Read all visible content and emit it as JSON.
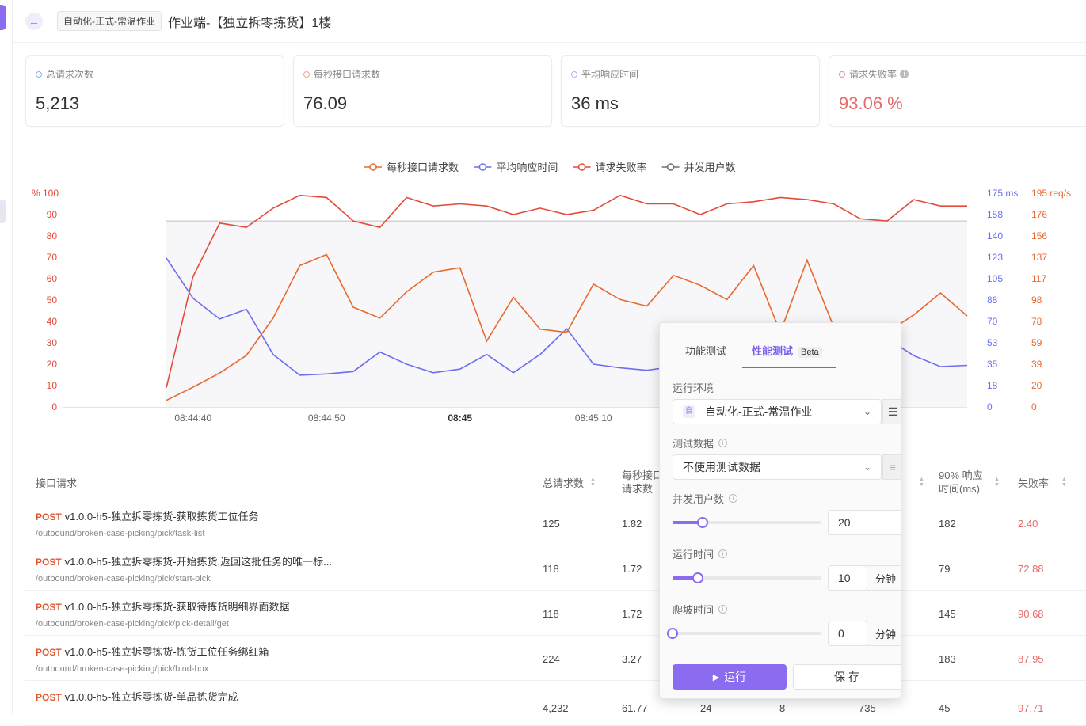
{
  "header": {
    "env_tag": "自动化-正式-常温作业",
    "title": "作业端-【独立拆零拣货】1楼"
  },
  "stats": [
    {
      "label": "总请求次数",
      "value": "5,213",
      "color": "#7fb3f0",
      "value_color": "#333333"
    },
    {
      "label": "每秒接口请求数",
      "value": "76.09",
      "color": "#f0a58a",
      "value_color": "#333333"
    },
    {
      "label": "平均响应时间",
      "value": "36 ms",
      "color": "#b9aef0",
      "value_color": "#333333"
    },
    {
      "label": "请求失败率",
      "value": "93.06 %",
      "color": "#f08a8a",
      "value_color": "#e86a6a"
    }
  ],
  "chart_data": {
    "type": "line",
    "legend": [
      "每秒接口请求数",
      "平均响应时间",
      "请求失败率",
      "并发用户数"
    ],
    "colors": {
      "每秒接口请求数": "#e8692f",
      "平均响应时间": "#6b6ff0",
      "请求失败率": "#e44a3a",
      "并发用户数": "#6e6e78"
    },
    "x_ticks": [
      {
        "label": "08:44:40",
        "idx": 1,
        "bold": false
      },
      {
        "label": "08:44:50",
        "idx": 6,
        "bold": false
      },
      {
        "label": "08:45",
        "idx": 11,
        "bold": true
      },
      {
        "label": "08:45:10",
        "idx": 16,
        "bold": false
      }
    ],
    "left_axis": {
      "unit": "%",
      "max": 100,
      "ticks": [
        "100",
        "90",
        "80",
        "70",
        "60",
        "50",
        "40",
        "30",
        "20",
        "10",
        "0"
      ]
    },
    "mid_axis": {
      "unit": "ms",
      "max": 175,
      "ticks": [
        "175 ms",
        "158",
        "140",
        "123",
        "105",
        "88",
        "70",
        "53",
        "35",
        "18",
        "0"
      ]
    },
    "right_axis": {
      "unit": "req/s",
      "max": 195,
      "ticks": [
        "195 req/s",
        "176",
        "156",
        "137",
        "117",
        "98",
        "78",
        "59",
        "39",
        "20",
        "0"
      ]
    },
    "x_count": 31,
    "series": [
      {
        "name": "每秒接口请求数",
        "axis": "right",
        "values": [
          6,
          18,
          31,
          47,
          81,
          129,
          139,
          91,
          81,
          105,
          123,
          127,
          60,
          100,
          71,
          68,
          112,
          98,
          92,
          120,
          111,
          98,
          129,
          68,
          134,
          73,
          74,
          68,
          84,
          104,
          83
        ]
      },
      {
        "name": "平均响应时间",
        "axis": "mid",
        "values": [
          122,
          89,
          72,
          80,
          43,
          26,
          27,
          29,
          45,
          35,
          28,
          31,
          43,
          28,
          43,
          64,
          35,
          32,
          30,
          33,
          31,
          31,
          34,
          35,
          31,
          32,
          40,
          56,
          42,
          33,
          34
        ]
      },
      {
        "name": "请求失败率",
        "axis": "left",
        "values": [
          9,
          61,
          86,
          84,
          93,
          99,
          98,
          87,
          84,
          98,
          94,
          95,
          94,
          90,
          93,
          90,
          92,
          99,
          95,
          95,
          90,
          95,
          96,
          98,
          97,
          95,
          88,
          87,
          97,
          94,
          94
        ]
      },
      {
        "name": "并发用户数",
        "axis": "left",
        "values": [
          87,
          87,
          87,
          87,
          87,
          87,
          87,
          87,
          87,
          87,
          87,
          87,
          87,
          87,
          87,
          87,
          87,
          87,
          87,
          87,
          87,
          87,
          87,
          87,
          87,
          87,
          87,
          87,
          87,
          87,
          87
        ]
      }
    ]
  },
  "table": {
    "headers": {
      "api": "接口请求",
      "total": "总请求数",
      "rps_line1": "每秒接口",
      "rps_line2": "请求数",
      "p90_line1": "90% 响应",
      "p90_line2": "时间(ms)",
      "fail": "失败率"
    },
    "rows": [
      {
        "method": "POST",
        "name": "v1.0.0-h5-独立拆零拣货-获取拣货工位任务",
        "path": "/outbound/broken-case-picking/pick/task-list",
        "total": "125",
        "rps": "1.82",
        "users": "",
        "col4": "",
        "col5": "",
        "p90": "182",
        "fail": "2.40"
      },
      {
        "method": "POST",
        "name": "v1.0.0-h5-独立拆零拣货-开始拣货,返回这批任务的唯一标...",
        "path": "/outbound/broken-case-picking/pick/start-pick",
        "total": "118",
        "rps": "1.72",
        "users": "",
        "col4": "",
        "col5": "",
        "p90": "79",
        "fail": "72.88"
      },
      {
        "method": "POST",
        "name": "v1.0.0-h5-独立拆零拣货-获取待拣货明细界面数据",
        "path": "/outbound/broken-case-picking/pick/pick-detail/get",
        "total": "118",
        "rps": "1.72",
        "users": "",
        "col4": "",
        "col5": "",
        "p90": "145",
        "fail": "90.68"
      },
      {
        "method": "POST",
        "name": "v1.0.0-h5-独立拆零拣货-拣货工位任务绑红箱",
        "path": "/outbound/broken-case-picking/pick/bind-box",
        "total": "224",
        "rps": "3.27",
        "users": "",
        "col4": "",
        "col5": "",
        "p90": "183",
        "fail": "87.95"
      },
      {
        "method": "POST",
        "name": "v1.0.0-h5-独立拆零拣货-单品拣货完成",
        "path": "",
        "total": "4,232",
        "rps": "61.77",
        "users": "24",
        "col4": "8",
        "col5": "735",
        "p90": "45",
        "fail": "97.71"
      }
    ]
  },
  "popup": {
    "tab_functional": "功能测试",
    "tab_performance": "性能测试",
    "beta": "Beta",
    "env_label": "运行环境",
    "env_value": "自动化-正式-常温作业",
    "env_icon_text": "自",
    "data_label": "测试数据",
    "data_value": "不使用测试数据",
    "users_label": "并发用户数",
    "users_value": "20",
    "users_level": 0.2,
    "duration_label": "运行时间",
    "duration_value": "10",
    "duration_unit": "分钟",
    "duration_level": 0.17,
    "ramp_label": "爬坡时间",
    "ramp_value": "0",
    "ramp_unit": "分钟",
    "ramp_level": 0,
    "run_label": "运行",
    "save_label": "保存"
  }
}
